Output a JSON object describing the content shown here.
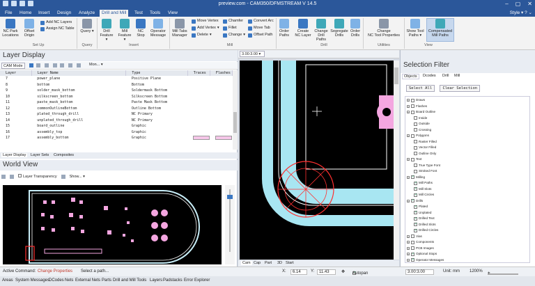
{
  "window": {
    "title": "preview.com - CAM350/DFMSTREAM V 14.5",
    "style_label": "Style"
  },
  "tabs": [
    "File",
    "Home",
    "Insert",
    "Design",
    "Analyze",
    "Drill and Mill",
    "Test",
    "Tools",
    "View"
  ],
  "active_tab": "Drill and Mill",
  "ribbon": {
    "setup": {
      "nc_park": "NC Park",
      "locations": "Locations",
      "offset": "Offset",
      "origin": "Origin",
      "add_nc_layers": "Add NC Layers",
      "assign_nc_table": "Assign NC Table",
      "group": "Set Up"
    },
    "query": {
      "label": "Query",
      "group": "Query"
    },
    "insert": {
      "drill": "Drill",
      "drill_feature": "Feature",
      "mill": "Mill",
      "mill_feature": "Feature",
      "nc_stop": "NC",
      "nc_stop2": "Stop",
      "operator": "Operator",
      "message": "Message",
      "group": "Insert"
    },
    "mill": {
      "tabs": "Mill Tabs",
      "manager": "Manager",
      "move_vertex": "Move Vertex",
      "add_vertex": "Add Vertex",
      "delete": "Delete",
      "chamfer": "Chamfer",
      "fillet": "Fillet",
      "change": "Change",
      "convert_arc": "Convert Arc",
      "move_tab": "Move Tab",
      "offset_path": "Offset Path",
      "group": "Mill"
    },
    "drill": {
      "order": "Order",
      "paths": "Paths",
      "create": "Create",
      "nc_layer": "NC Layer",
      "change_drill": "Change",
      "drill_paths": "Drill Paths",
      "segregate": "Segregate",
      "drills": "Drills",
      "order_drills": "Order",
      "drills2": "Drills",
      "group": "Drill"
    },
    "utilities": {
      "change": "Change",
      "nc_tool_props": "NC Tool Properties",
      "group": "Utilities"
    },
    "view": {
      "show_tool": "Show Tool",
      "paths": "Paths",
      "compensated": "Compensated",
      "mill_paths": "Mill Paths",
      "group": "View"
    }
  },
  "layer_display": {
    "title": "Layer Display",
    "mode": "CAM Mode",
    "toolbar_label": "Mon...",
    "columns": [
      "Layer",
      "Layer Name",
      "Type",
      "Traces",
      "Flashes"
    ],
    "rows": [
      [
        "7",
        "power_plane",
        "Positive Plane"
      ],
      [
        "8",
        "bottom",
        "Bottom"
      ],
      [
        "9",
        "solder_mask_bottom",
        "Soldermask Bottom"
      ],
      [
        "10",
        "silkscreen_bottom",
        "Silkscreen Bottom"
      ],
      [
        "11",
        "paste_mask_bottom",
        "Paste Mask Bottom"
      ],
      [
        "12",
        "commonOutlineBottom",
        "Outline Bottom"
      ],
      [
        "13",
        "plated_through_drill",
        "NC Primary"
      ],
      [
        "14",
        "unplated_through_drill",
        "NC Primary"
      ],
      [
        "15",
        "board_outline",
        "Graphic"
      ],
      [
        "16",
        "assembly_top",
        "Graphic"
      ],
      [
        "17",
        "assembly_bottom",
        "Graphic"
      ]
    ],
    "tabs": [
      "Layer Display",
      "Layer Sets",
      "Composites"
    ]
  },
  "world_view": {
    "title": "World View",
    "transparency_label": "Layer Transparency",
    "show_label": "Show..."
  },
  "main": {
    "zoom_field": "3.00:3.00",
    "tabs": [
      "Cam",
      "Cap",
      "Part",
      "3D",
      "Start"
    ]
  },
  "selection_filter": {
    "title": "Selection Filter",
    "tabs": [
      "Objects",
      "Dcodes",
      "Drill",
      "Mill"
    ],
    "select_all": "Select All",
    "clear_selection": "Clear Selection",
    "items": [
      {
        "label": "Draws",
        "level": 0,
        "checked": false
      },
      {
        "label": "Flashes",
        "level": 0,
        "checked": false
      },
      {
        "label": "Board Outline",
        "level": 0,
        "checked": false
      },
      {
        "label": "Inside",
        "level": 1,
        "checked": false
      },
      {
        "label": "Outside",
        "level": 1,
        "checked": false
      },
      {
        "label": "Crossing",
        "level": 1,
        "checked": false
      },
      {
        "label": "Polygons",
        "level": 0,
        "checked": false
      },
      {
        "label": "Raster Filled",
        "level": 1,
        "checked": false
      },
      {
        "label": "Vector Filled",
        "level": 1,
        "checked": false
      },
      {
        "label": "Outline Only",
        "level": 1,
        "checked": false
      },
      {
        "label": "Text",
        "level": 0,
        "checked": false
      },
      {
        "label": "True Type Font",
        "level": 1,
        "checked": false
      },
      {
        "label": "Stroked Font",
        "level": 1,
        "checked": false
      },
      {
        "label": "Milling",
        "level": 0,
        "checked": true
      },
      {
        "label": "Mill Paths",
        "level": 1,
        "checked": true
      },
      {
        "label": "Mill Slots",
        "level": 1,
        "checked": true
      },
      {
        "label": "Mill Circles",
        "level": 1,
        "checked": true
      },
      {
        "label": "Drills",
        "level": 0,
        "checked": true
      },
      {
        "label": "Plated",
        "level": 1,
        "checked": true
      },
      {
        "label": "Unplated",
        "level": 1,
        "checked": true
      },
      {
        "label": "Drilled Text",
        "level": 1,
        "checked": true
      },
      {
        "label": "Drilled Slots",
        "level": 1,
        "checked": true
      },
      {
        "label": "Drilled Circles",
        "level": 1,
        "checked": true
      },
      {
        "label": "Vias",
        "level": 0,
        "checked": false
      },
      {
        "label": "Components",
        "level": 0,
        "checked": false
      },
      {
        "label": "PCB Images",
        "level": 0,
        "checked": false
      },
      {
        "label": "Optional Stops",
        "level": 0,
        "checked": true
      },
      {
        "label": "Operator Messages",
        "level": 0,
        "checked": true
      }
    ]
  },
  "status": {
    "active_command_label": "Active Command:",
    "active_command": "Change Properties",
    "prompt": "Select a path...",
    "x_label": "X:",
    "x_value": "6.14",
    "y_label": "Y:",
    "y_value": "11.43",
    "autopan": "Autopan",
    "grid": "3.00:3.00",
    "unit": "Unit: mm",
    "zoom": "1200%"
  },
  "bottom_tabs": [
    "Areas",
    "System Messages",
    "DCodes",
    "Nets",
    "External Nets",
    "Parts",
    "Drill and Mill Tools",
    "Layers",
    "Padstacks",
    "Error Explorer"
  ],
  "colors": {
    "titlebar": "#2b579a",
    "mill_path": "#a8e6f2",
    "pad": "#f4a6e0",
    "drill": "#ff3030"
  }
}
